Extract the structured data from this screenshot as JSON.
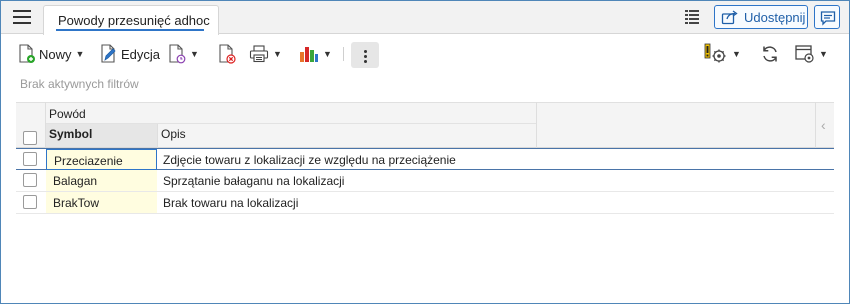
{
  "tab": {
    "title": "Powody przesunięć adhoc"
  },
  "header": {
    "share_label": "Udostępnij"
  },
  "toolbar": {
    "new_label": "Nowy",
    "edit_label": "Edycja"
  },
  "filters": {
    "status_text": "Brak aktywnych filtrów"
  },
  "grid": {
    "group_header": "Powód",
    "columns": {
      "symbol": "Symbol",
      "opis": "Opis"
    },
    "rows": [
      {
        "symbol": "Przeciazenie",
        "opis": "Zdjęcie towaru z lokalizacji ze względu na przeciążenie",
        "selected": true
      },
      {
        "symbol": "Balagan",
        "opis": "Sprzątanie bałaganu na lokalizacji",
        "selected": false
      },
      {
        "symbol": "BrakTow",
        "opis": "Brak towaru na lokalizacji",
        "selected": false
      }
    ]
  },
  "colors": {
    "accent": "#2e75c8",
    "symbol_cell_bg": "#fffde0",
    "alert_yellow": "#f5c400"
  },
  "icons": [
    "menu-icon",
    "list-view-icon",
    "share-icon",
    "chat-icon",
    "new-doc-icon",
    "edit-doc-icon",
    "doc-history-icon",
    "doc-delete-icon",
    "print-icon",
    "chart-icon",
    "more-vert-icon",
    "settings-alert-icon",
    "refresh-icon",
    "window-settings-icon",
    "chevron-left-icon"
  ]
}
